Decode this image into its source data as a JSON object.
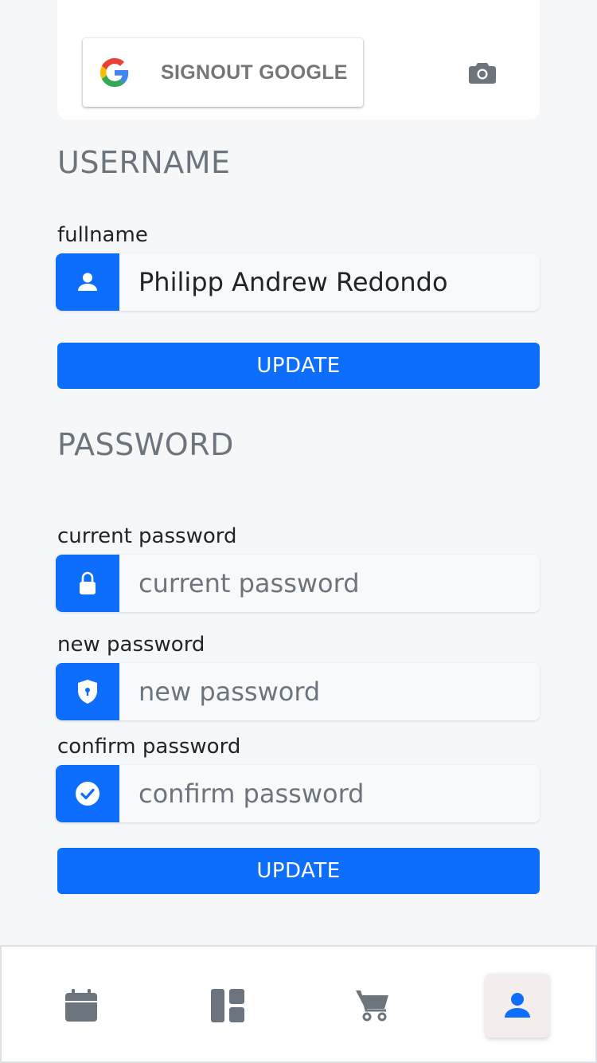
{
  "profile": {
    "google_button_label": "SIGNOUT GOOGLE"
  },
  "username_section": {
    "title": "USERNAME",
    "fullname_label": "fullname",
    "fullname_value": "Philipp Andrew Redondo",
    "update_label": "UPDATE"
  },
  "password_section": {
    "title": "PASSWORD",
    "current_label": "current password",
    "current_placeholder": "current password",
    "new_label": "new password",
    "new_placeholder": "new password",
    "confirm_label": "confirm password",
    "confirm_placeholder": "confirm password",
    "update_label": "UPDATE"
  },
  "bottom_nav": {
    "items": [
      {
        "icon": "calendar-icon",
        "active": false
      },
      {
        "icon": "dashboard-icon",
        "active": false
      },
      {
        "icon": "cart-icon",
        "active": false
      },
      {
        "icon": "person-icon",
        "active": true
      }
    ]
  },
  "colors": {
    "accent": "#0d6efd",
    "background": "#f6f7f9",
    "icon_gray": "#6c757d"
  }
}
